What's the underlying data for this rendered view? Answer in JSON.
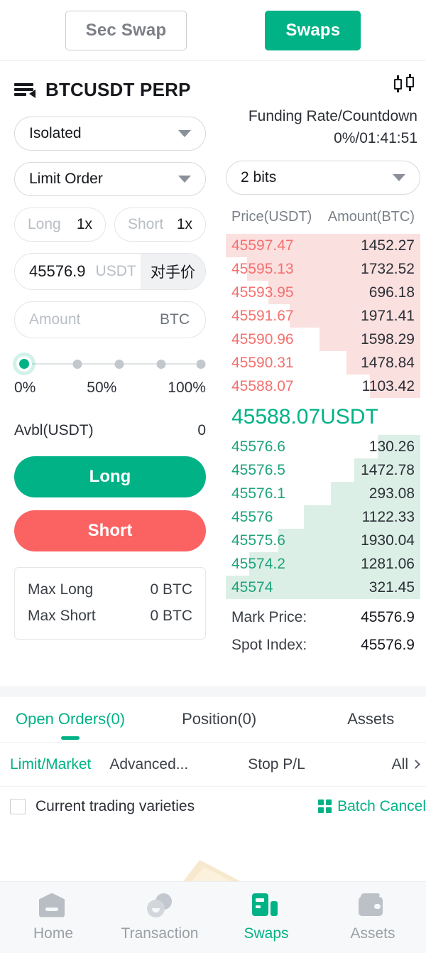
{
  "topbar": {
    "sec_swap_label": "Sec Swap",
    "swaps_label": "Swaps"
  },
  "header": {
    "symbol": "BTCUSDT PERP",
    "menu_icon": "list-filter-icon",
    "chart_icon": "candlestick-icon",
    "funding_label": "Funding Rate/Countdown",
    "funding_value": "0%/01:41:51"
  },
  "order_form": {
    "margin_mode": "Isolated",
    "order_type": "Limit Order",
    "long_side_label": "Long",
    "long_leverage": "1x",
    "short_side_label": "Short",
    "short_leverage": "1x",
    "price_value": "45576.9",
    "price_unit": "USDT",
    "price_tag": "对手价",
    "amount_placeholder": "Amount",
    "amount_unit": "BTC",
    "slider_ticks": [
      "0%",
      "50%",
      "100%"
    ],
    "slider_position_percent": 0,
    "available_label": "Avbl(USDT)",
    "available_value": "0",
    "long_button": "Long",
    "short_button": "Short",
    "max_long_label": "Max Long",
    "max_long_value": "0 BTC",
    "max_short_label": "Max Short",
    "max_short_value": "0 BTC"
  },
  "orderbook": {
    "precision": "2 bits",
    "col_price": "Price(USDT)",
    "col_amount": "Amount(BTC)",
    "asks": [
      {
        "price": "45597.47",
        "amount": "1452.27",
        "depth": 100
      },
      {
        "price": "45595.13",
        "amount": "1732.52",
        "depth": 89
      },
      {
        "price": "45593.95",
        "amount": "696.18",
        "depth": 78
      },
      {
        "price": "45591.67",
        "amount": "1971.41",
        "depth": 67
      },
      {
        "price": "45590.96",
        "amount": "1598.29",
        "depth": 52
      },
      {
        "price": "45590.31",
        "amount": "1478.84",
        "depth": 38
      },
      {
        "price": "45588.07",
        "amount": "1103.42",
        "depth": 26
      }
    ],
    "last_price": "45588.07USDT",
    "bids": [
      {
        "price": "45576.6",
        "amount": "130.26",
        "depth": 22
      },
      {
        "price": "45576.5",
        "amount": "1472.78",
        "depth": 34
      },
      {
        "price": "45576.1",
        "amount": "293.08",
        "depth": 46
      },
      {
        "price": "45576",
        "amount": "1122.33",
        "depth": 60
      },
      {
        "price": "45575.6",
        "amount": "1930.04",
        "depth": 73
      },
      {
        "price": "45574.2",
        "amount": "1281.06",
        "depth": 88
      },
      {
        "price": "45574",
        "amount": "321.45",
        "depth": 100
      }
    ],
    "mark_price_label": "Mark Price:",
    "mark_price_value": "45576.9",
    "spot_index_label": "Spot Index:",
    "spot_index_value": "45576.9"
  },
  "tabs": [
    {
      "label": "Open Orders(0)",
      "active": true
    },
    {
      "label": "Position(0)",
      "active": false
    },
    {
      "label": "Assets",
      "active": false
    }
  ],
  "filters": [
    {
      "label": "Limit/Market",
      "active": true
    },
    {
      "label": "Advanced...",
      "active": false
    },
    {
      "label": "Stop P/L",
      "active": false
    }
  ],
  "filter_all": "All",
  "checkbox": {
    "label": "Current trading varieties",
    "checked": false
  },
  "batch_cancel": {
    "label": "Batch Cancel",
    "icon": "grid-icon"
  },
  "bottom_nav": [
    {
      "label": "Home",
      "icon": "home-icon",
      "active": false
    },
    {
      "label": "Transaction",
      "icon": "transaction-icon",
      "active": false
    },
    {
      "label": "Swaps",
      "icon": "swaps-icon",
      "active": true
    },
    {
      "label": "Assets",
      "icon": "wallet-icon",
      "active": false
    }
  ],
  "colors": {
    "accent": "#00b286",
    "ask_red": "#f2716f",
    "short_red": "#fb6363",
    "ask_bar": "#fbe0e0",
    "bid_bar": "#dcefe6"
  }
}
